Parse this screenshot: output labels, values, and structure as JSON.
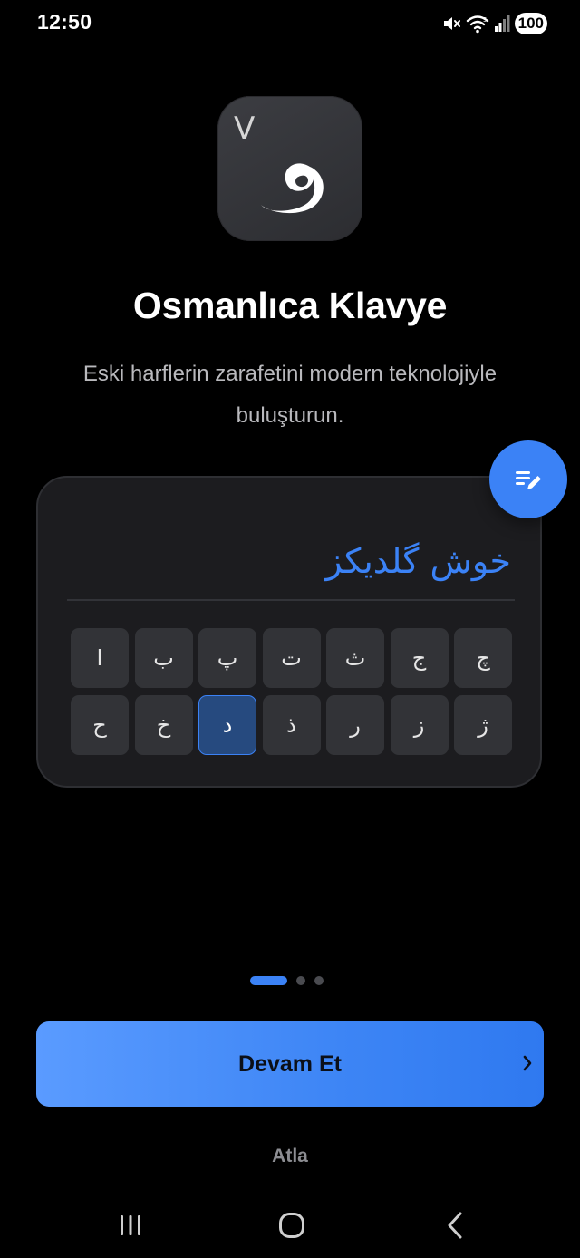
{
  "status_bar": {
    "time": "12:50",
    "battery": "100",
    "icons": [
      "mute-icon",
      "wifi-icon",
      "signal-icon",
      "battery-icon"
    ]
  },
  "app_icon": {
    "glyph": "و",
    "version_mark": "V",
    "icon": "app-logo"
  },
  "title": "Osmanlıca Klavye",
  "subtitle": "Eski harflerin zarafetini modern teknolojiyle buluşturun.",
  "keyboard_preview": {
    "text": "خوش گلدیکز",
    "rows": [
      [
        "ا",
        "ب",
        "پ",
        "ت",
        "ث",
        "ج",
        "چ"
      ],
      [
        "ح",
        "خ",
        "د",
        "ذ",
        "ر",
        "ز",
        "ژ"
      ]
    ],
    "active_key": "د",
    "edit_icon": "edit-note-icon"
  },
  "pager": {
    "count": 3,
    "active": 0
  },
  "continue_button": {
    "label": "Devam Et",
    "icon": "chevron-right-icon"
  },
  "skip_label": "Atla",
  "navigation": [
    "recent-apps-icon",
    "home-icon",
    "back-icon"
  ],
  "colors": {
    "accent": "#3b82f6",
    "background": "#000000",
    "card": "#1c1c1f",
    "key": "#323337",
    "active_key": "#264a7f"
  }
}
